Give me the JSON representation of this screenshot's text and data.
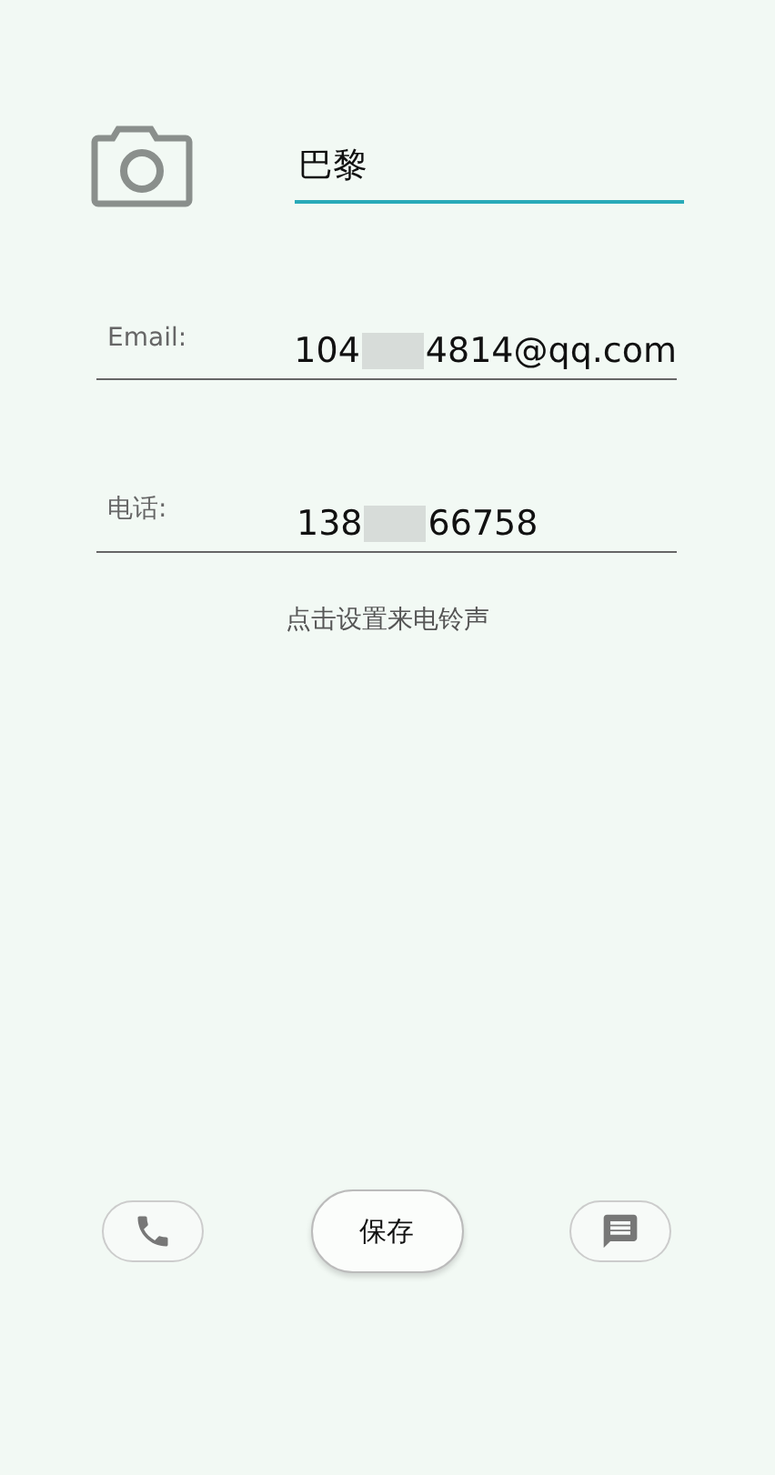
{
  "name_field": {
    "value": "巴黎",
    "focused": true
  },
  "fields": [
    {
      "label": "Email:",
      "value_start": "104",
      "value_end": "4814@qq.com"
    },
    {
      "label": "电话:",
      "value_start": "138",
      "value_end": "66758"
    }
  ],
  "ringtone_link": "点击设置来电铃声",
  "bottom_bar": {
    "save_button": "保存"
  }
}
